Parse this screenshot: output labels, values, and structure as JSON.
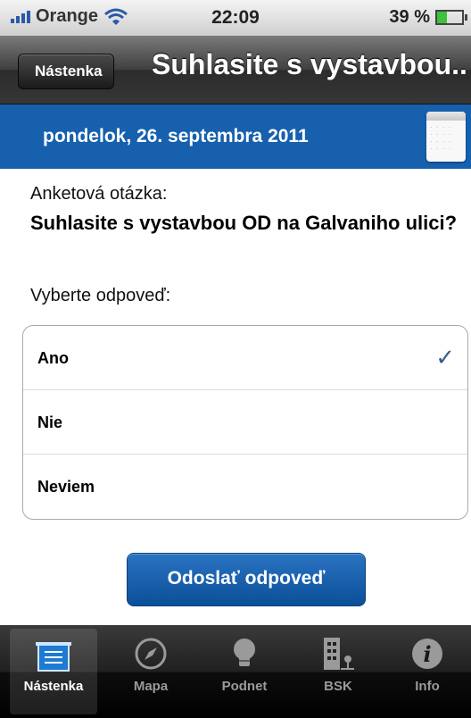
{
  "status": {
    "carrier": "Orange",
    "time": "22:09",
    "battery": "39 %",
    "battery_level": 0.39
  },
  "nav": {
    "back_label": "Nástenka",
    "title": "Suhlasite s vystavbou..."
  },
  "date_band": {
    "date": "pondelok, 26. septembra 2011",
    "icon": "calendar-icon"
  },
  "poll": {
    "question_label": "Anketová otázka:",
    "question": "Suhlasite s vystavbou OD na Galvaniho ulici?",
    "choose_label": "Vyberte odpoveď:",
    "options": [
      {
        "label": "Ano",
        "selected": true
      },
      {
        "label": "Nie",
        "selected": false
      },
      {
        "label": "Neviem",
        "selected": false
      }
    ],
    "check_mark": "✓",
    "submit_label": "Odoslať odpoveď"
  },
  "tabs": [
    {
      "label": "Nástenka",
      "icon": "board-icon",
      "active": true
    },
    {
      "label": "Mapa",
      "icon": "compass-icon",
      "active": false
    },
    {
      "label": "Podnet",
      "icon": "lightbulb-icon",
      "active": false
    },
    {
      "label": "BSK",
      "icon": "building-icon",
      "active": false
    },
    {
      "label": "Info",
      "icon": "info-icon",
      "active": false
    }
  ],
  "colors": {
    "accent": "#1660ae",
    "check": "#3b5c8f"
  }
}
